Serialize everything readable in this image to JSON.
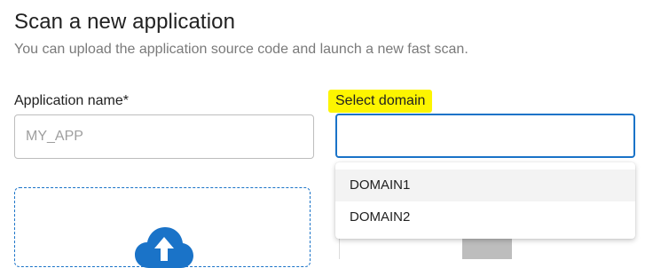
{
  "page": {
    "title": "Scan a new application",
    "subtitle": "You can upload the application source code and launch a new fast scan."
  },
  "form": {
    "app_name_label": "Application name*",
    "app_name_placeholder": "MY_APP",
    "app_name_value": "",
    "domain_label": "Select domain",
    "domain_value": ""
  },
  "domain_dropdown": {
    "options": [
      "DOMAIN1",
      "DOMAIN2"
    ],
    "highlighted_index": 0
  },
  "upload": {
    "icon": "cloud-upload-icon"
  },
  "colors": {
    "accent": "#1a73c8",
    "highlight": "#fdf500",
    "subtitle_text": "#7a7a7a",
    "option_hover": "#f3f3f3"
  }
}
